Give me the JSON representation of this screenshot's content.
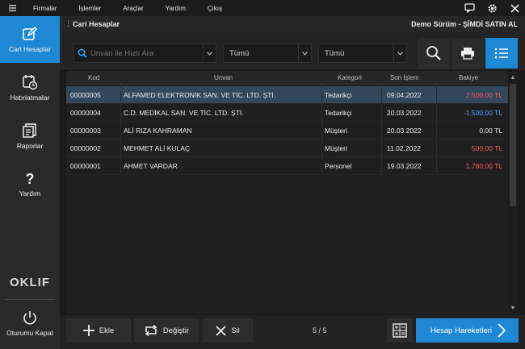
{
  "menu": {
    "items": [
      "Firmalar",
      "İşlemler",
      "Araçlar",
      "Yardım",
      "Çıkış"
    ]
  },
  "header": {
    "title": "Cari Hesaplar",
    "demo": "Demo Sürüm - ŞİMDİ SATIN AL"
  },
  "sidebar": {
    "items": [
      {
        "label": "Cari Hesaplar",
        "icon": "edit-icon"
      },
      {
        "label": "Hatırlatmalar",
        "icon": "calendar-clock-icon"
      },
      {
        "label": "Raporlar",
        "icon": "reports-icon"
      },
      {
        "label": "Yardım",
        "icon": "question-icon"
      }
    ],
    "logo": "OKLIF",
    "logout": "Oturumu Kapat"
  },
  "toolbar": {
    "search_placeholder": "Unvan ile Hızlı Ara",
    "filter1": "Tümü",
    "filter2": "Tümü"
  },
  "table": {
    "columns": [
      "Kod",
      "Unvan",
      "Kategori",
      "Son İşlem",
      "Bakiye"
    ],
    "rows": [
      {
        "kod": "00000005",
        "unvan": "ALFAMED ELEKTRONİK SAN. VE TİC. LTD. ŞTİ.",
        "kategori": "Tedarikçi",
        "son_islem": "09.04.2022",
        "bakiye": "2.500,00 TL"
      },
      {
        "kod": "00000004",
        "unvan": "C.D. MEDİKAL SAN. VE TİC. LTD. ŞTİ.",
        "kategori": "Tedarikçi",
        "son_islem": "20.03.2022",
        "bakiye": "-1.500,00 TL"
      },
      {
        "kod": "00000003",
        "unvan": "ALİ RIZA KAHRAMAN",
        "kategori": "Müşteri",
        "son_islem": "20.03.2022",
        "bakiye": "0,00 TL"
      },
      {
        "kod": "00000002",
        "unvan": "MEHMET ALİ KULAÇ",
        "kategori": "Müşteri",
        "son_islem": "11.02.2022",
        "bakiye": "500,00 TL"
      },
      {
        "kod": "00000001",
        "unvan": "AHMET VARDAR",
        "kategori": "Personel",
        "son_islem": "19.03.2022",
        "bakiye": "1.780,00 TL"
      }
    ]
  },
  "bottom": {
    "add": "Ekle",
    "edit": "Değiştir",
    "delete": "Sil",
    "pager": "5 / 5",
    "movements": "Hesap Hareketleri"
  },
  "colors": {
    "accent": "#1e88d4",
    "positive_balance": "#ff5a5a",
    "negative_balance": "#4aa3ff"
  }
}
